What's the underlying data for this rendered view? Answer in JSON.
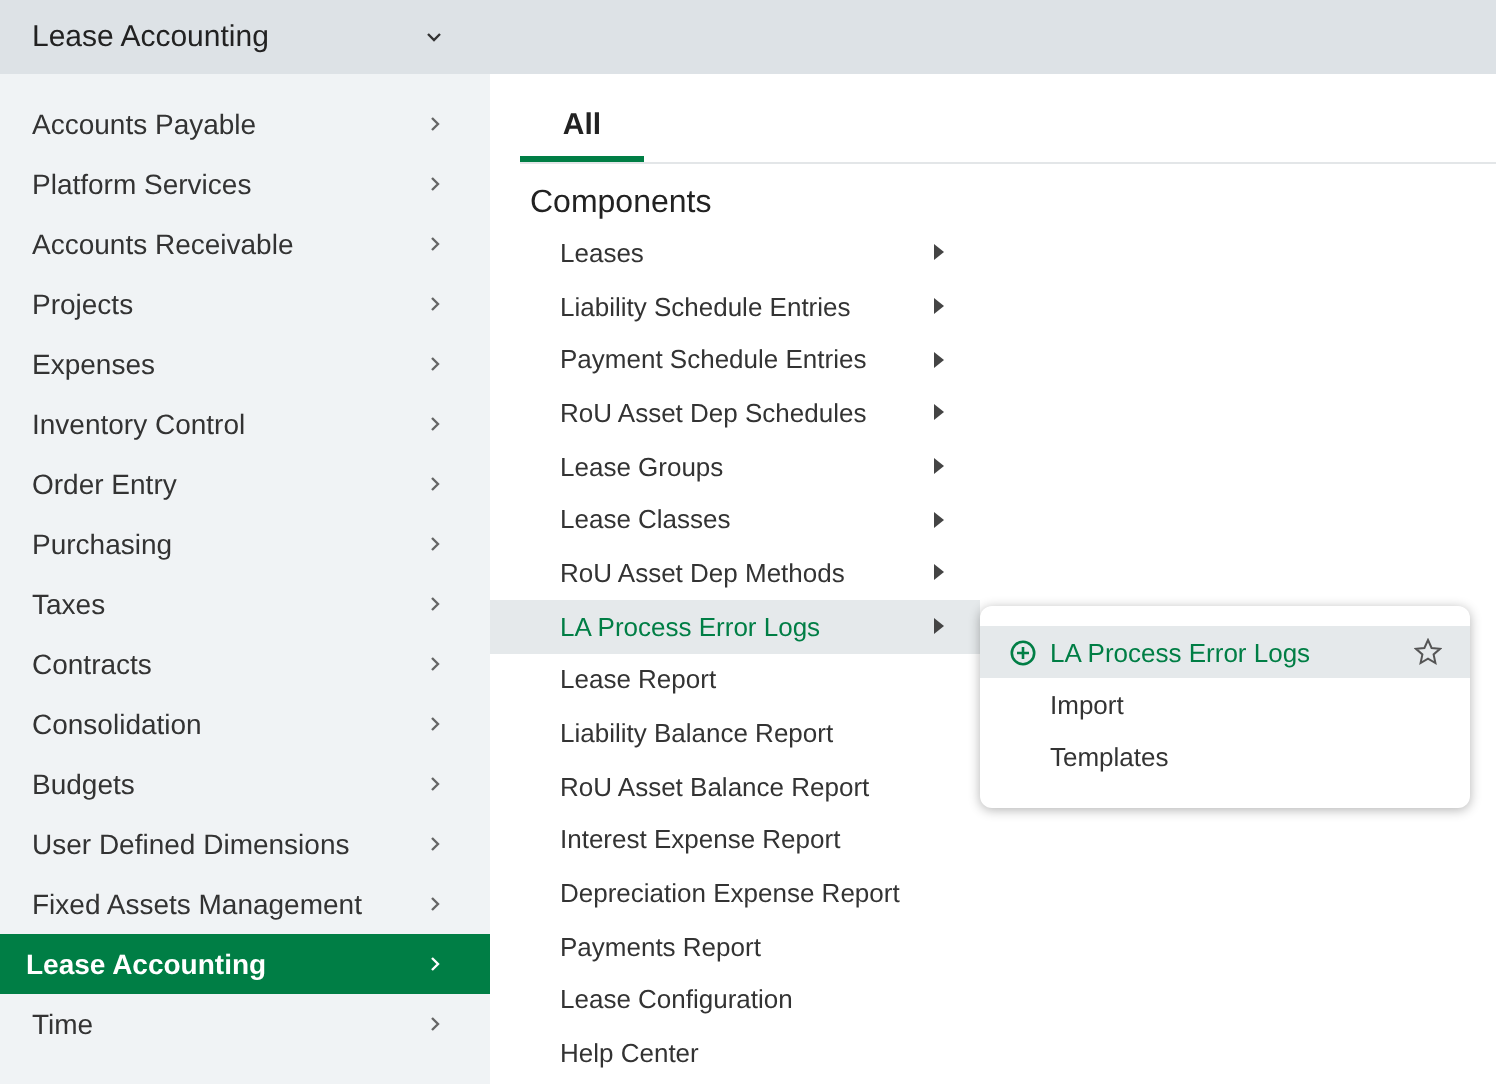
{
  "header": {
    "title": "Lease Accounting",
    "expanded": true
  },
  "sidebar": {
    "items": [
      {
        "label": "Accounts Payable",
        "selected": false
      },
      {
        "label": "Platform Services",
        "selected": false
      },
      {
        "label": "Accounts Receivable",
        "selected": false
      },
      {
        "label": "Projects",
        "selected": false
      },
      {
        "label": "Expenses",
        "selected": false
      },
      {
        "label": "Inventory Control",
        "selected": false
      },
      {
        "label": "Order Entry",
        "selected": false
      },
      {
        "label": "Purchasing",
        "selected": false
      },
      {
        "label": "Taxes",
        "selected": false
      },
      {
        "label": "Contracts",
        "selected": false
      },
      {
        "label": "Consolidation",
        "selected": false
      },
      {
        "label": "Budgets",
        "selected": false
      },
      {
        "label": "User Defined Dimensions",
        "selected": false
      },
      {
        "label": "Fixed Assets Management",
        "selected": false
      },
      {
        "label": "Lease Accounting",
        "selected": true
      },
      {
        "label": "Time",
        "selected": false
      }
    ]
  },
  "tabs": [
    {
      "label": "All",
      "selected": true
    }
  ],
  "section": {
    "heading": "Components",
    "items": [
      {
        "label": "Leases",
        "has_submenu": true,
        "selected": false
      },
      {
        "label": "Liability Schedule Entries",
        "has_submenu": true,
        "selected": false
      },
      {
        "label": "Payment Schedule Entries",
        "has_submenu": true,
        "selected": false
      },
      {
        "label": "RoU Asset Dep Schedules",
        "has_submenu": true,
        "selected": false
      },
      {
        "label": "Lease Groups",
        "has_submenu": true,
        "selected": false
      },
      {
        "label": "Lease Classes",
        "has_submenu": true,
        "selected": false
      },
      {
        "label": "RoU Asset Dep Methods",
        "has_submenu": true,
        "selected": false
      },
      {
        "label": "LA Process Error Logs",
        "has_submenu": true,
        "selected": true
      },
      {
        "label": "Lease Report",
        "has_submenu": false,
        "selected": false
      },
      {
        "label": "Liability Balance Report",
        "has_submenu": false,
        "selected": false
      },
      {
        "label": "RoU Asset Balance Report",
        "has_submenu": false,
        "selected": false
      },
      {
        "label": "Interest Expense Report",
        "has_submenu": false,
        "selected": false
      },
      {
        "label": "Depreciation Expense Report",
        "has_submenu": false,
        "selected": false
      },
      {
        "label": "Payments Report",
        "has_submenu": false,
        "selected": false
      },
      {
        "label": "Lease Configuration",
        "has_submenu": false,
        "selected": false
      },
      {
        "label": "Help Center",
        "has_submenu": false,
        "selected": false
      }
    ]
  },
  "submenu": {
    "items": [
      {
        "label": "LA Process Error Logs",
        "kind": "add",
        "selected": true
      },
      {
        "label": "Import",
        "kind": "plain",
        "selected": false
      },
      {
        "label": "Templates",
        "kind": "plain",
        "selected": false
      }
    ]
  }
}
